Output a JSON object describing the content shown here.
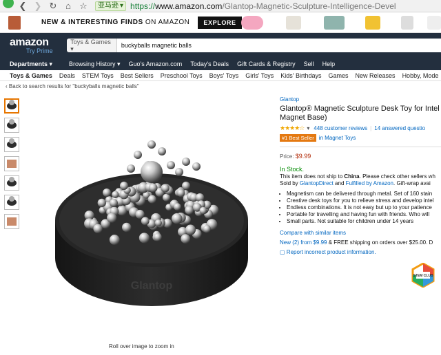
{
  "browser": {
    "back_icon": "chevron-left",
    "forward_icon": "chevron-right",
    "site_tag": "亚马逊",
    "url_scheme": "https://",
    "url_host": "www.amazon.com",
    "url_path": "/Glantop-Magnetic-Sculpture-Intelligence-Devel"
  },
  "promo": {
    "text_bold": "NEW & INTERESTING FINDS",
    "text_rest": " ON AMAZON",
    "explore": "EXPLORE"
  },
  "header": {
    "logo": "amazon",
    "try_prime": "Try Prime",
    "search_category": "Toys & Games ▾",
    "search_value": "buckyballs magnetic balls"
  },
  "nav": {
    "departments": "Departments ▾",
    "links": [
      "Browsing History ▾",
      "Guo's Amazon.com",
      "Today's Deals",
      "Gift Cards & Registry",
      "Sell",
      "Help"
    ]
  },
  "subnav": [
    "Toys & Games",
    "Deals",
    "STEM Toys",
    "Best Sellers",
    "Preschool Toys",
    "Boys' Toys",
    "Girls' Toys",
    "Kids' Birthdays",
    "Games",
    "New Releases",
    "Hobby, Mode"
  ],
  "breadcrumb": "‹ Back to search results for \"buckyballs magnetic balls\"",
  "product": {
    "brand": "Glantop",
    "title_line1": "Glantop® Magnetic Sculpture Desk Toy for Intel",
    "title_line2": "Magnet Base)",
    "stars": "★★★★☆",
    "reviews": "448 customer reviews",
    "answered": "14 answered questio",
    "badge": "#1 Best Seller",
    "badge_category": "in Magnet Toys",
    "price_label": "Price:",
    "price": "$9.99",
    "stock": "In Stock.",
    "ship_note_pre": "This item does not ship to ",
    "ship_note_country": "China",
    "ship_note_post": ". Please check other sellers wh",
    "sold_by_pre": "Sold by ",
    "seller": "GlantopDirect",
    "sold_mid": " and ",
    "fulfilled": "Fulfilled by Amazon",
    "sold_post": ". Gift-wrap avai",
    "bullets": [
      "Magnetism can be delivered through metal. Set of 160 stain",
      "Creative desk toys for you to relieve stress and develop intel",
      "Endless combinations. It is not easy but up to your patience",
      "Portable for travelling and having fun with friends. Who will",
      "Small parts. Not suitable for children under 14 years"
    ],
    "compare": "Compare with similar items",
    "new_offers": "New (2) from $9.99",
    "new_rest": " & FREE shipping on orders over $25.00. D",
    "report": "Report incorrect product information.",
    "stem_badge": "STEM CLUB",
    "image_caption": "Roll over image to zoom in"
  }
}
